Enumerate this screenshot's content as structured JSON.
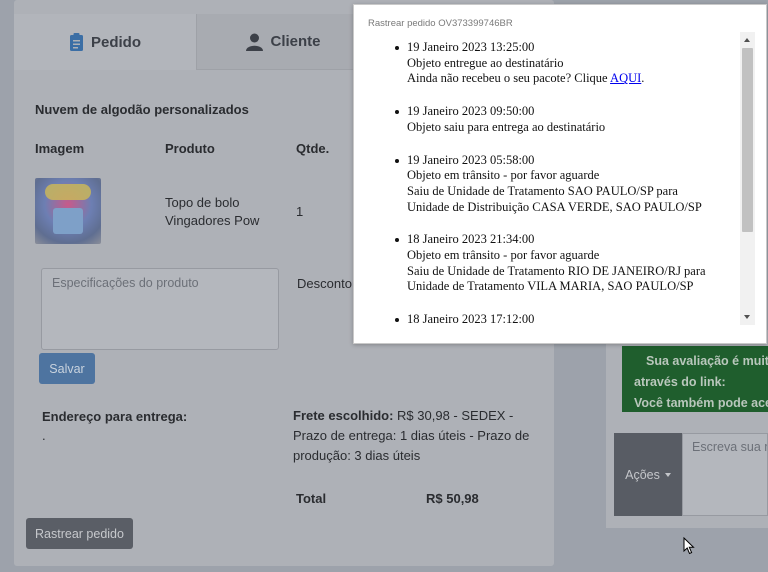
{
  "tabs": [
    {
      "label": "Pedido",
      "icon": "clipboard-icon",
      "active": true
    },
    {
      "label": "Cliente",
      "icon": "user-icon",
      "active": false
    }
  ],
  "order": {
    "product_title": "Nuvem de algodão personalizados",
    "headers": {
      "image": "Imagem",
      "product": "Produto",
      "qty": "Qtde."
    },
    "item": {
      "product_line1": "Topo de bolo",
      "product_line2": "Vingadores Pow",
      "qty": "1"
    },
    "specs_placeholder": "Especificações do produto",
    "discount_label": "Desconto",
    "save_label": "Salvar",
    "address_label": "Endereço para entrega:",
    "address_value": ".",
    "shipping_label": "Frete escolhido:",
    "shipping_line1": "R$ 30,98 - SEDEX -",
    "shipping_line2": "Prazo de entrega: 1 dias úteis - Prazo de",
    "shipping_line3": "produção: 3 dias úteis",
    "total_label": "Total",
    "total_value": "R$ 50,98",
    "track_label": "Rastrear pedido"
  },
  "side": {
    "rating_line1": "Sua avaliação é muito",
    "rating_line2_label": "através do link:",
    "rating_line3": "Você também pode ace",
    "actions_label": "Ações",
    "message_placeholder": "Escreva sua m"
  },
  "popup": {
    "title": "Rastrear pedido OV373399746BR",
    "events": [
      {
        "date": "19 Janeiro 2023 13:25:00",
        "lines": [
          "Objeto entregue ao destinatário"
        ],
        "extra": "Ainda não recebeu o seu pacote? Clique ",
        "link": "AQUI",
        "extra_end": "."
      },
      {
        "date": "19 Janeiro 2023 09:50:00",
        "lines": [
          "Objeto saiu para entrega ao destinatário"
        ]
      },
      {
        "date": "19 Janeiro 2023 05:58:00",
        "lines": [
          "Objeto em trânsito - por favor aguarde",
          "Saiu de Unidade de Tratamento SAO PAULO/SP para",
          "Unidade de Distribuição CASA VERDE, SAO PAULO/SP"
        ]
      },
      {
        "date": "18 Janeiro 2023 21:34:00",
        "lines": [
          "Objeto em trânsito - por favor aguarde",
          "Saiu de Unidade de Tratamento RIO DE JANEIRO/RJ para",
          "Unidade de Tratamento VILA MARIA, SAO PAULO/SP"
        ]
      },
      {
        "date": "18 Janeiro 2023 17:12:00",
        "lines": []
      }
    ]
  }
}
